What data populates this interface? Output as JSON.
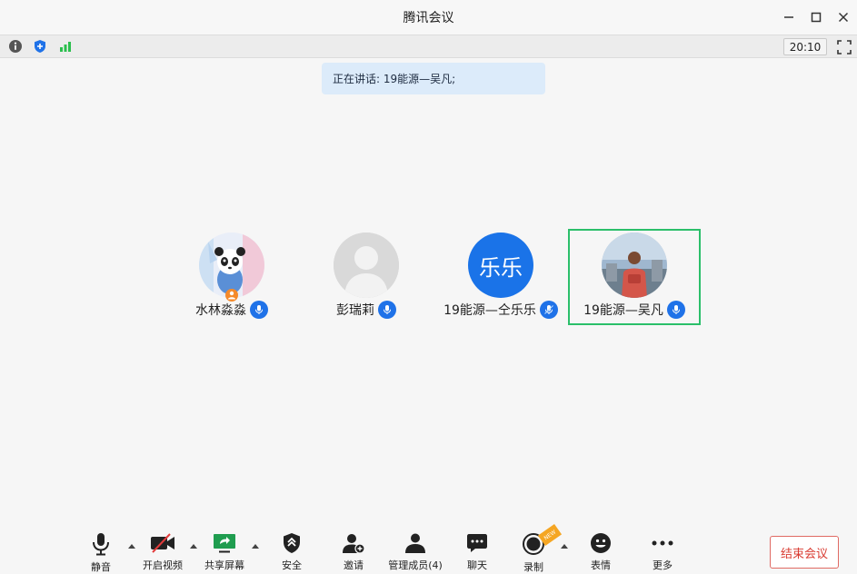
{
  "window": {
    "title": "腾讯会议",
    "minimize_glyph": "—",
    "maximize_glyph": "☐",
    "close_glyph": "✕"
  },
  "statusbar": {
    "timer": "20:10",
    "icons": [
      "info-icon",
      "shield-icon",
      "signal-icon",
      "fullscreen-icon"
    ]
  },
  "banner": {
    "text": "正在讲话: 19能源—吴凡;"
  },
  "participants": [
    {
      "name": "水林淼淼",
      "avatar_type": "anime-panda",
      "host": true,
      "mic": "on",
      "active": false
    },
    {
      "name": "彭瑞莉",
      "avatar_type": "default-silhouette",
      "host": false,
      "mic": "on",
      "active": false
    },
    {
      "name": "19能源—仝乐乐",
      "avatar_type": "text",
      "avatar_text": "乐乐",
      "avatar_color": "#1a73e8",
      "host": false,
      "mic": "speaking",
      "active": false
    },
    {
      "name": "19能源—吴凡",
      "avatar_type": "photo",
      "host": false,
      "mic": "on",
      "active": true
    }
  ],
  "toolbar": {
    "mute": "静音",
    "video": "开启视频",
    "share": "共享屏幕",
    "security": "安全",
    "invite": "邀请",
    "members": "管理成员(4)",
    "chat": "聊天",
    "record": "录制",
    "record_badge": "NEW",
    "reactions": "表情",
    "more": "更多",
    "end": "结束会议"
  },
  "colors": {
    "accent": "#1f72e8",
    "active_border": "#2bbf6a",
    "end_red": "#d93b31",
    "banner_bg": "#dcebfa"
  }
}
